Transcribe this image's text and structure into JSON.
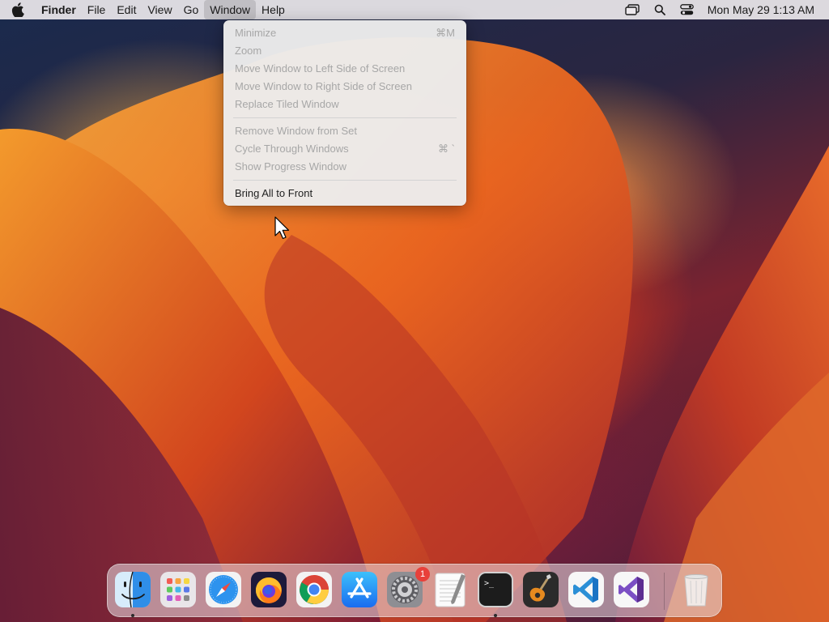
{
  "menubar": {
    "apple_icon": "apple-logo-icon",
    "items": [
      {
        "label": "Finder",
        "bold": true
      },
      {
        "label": "File"
      },
      {
        "label": "Edit"
      },
      {
        "label": "View"
      },
      {
        "label": "Go"
      },
      {
        "label": "Window",
        "active": true
      },
      {
        "label": "Help"
      }
    ],
    "status_icons": [
      "window-switcher-icon",
      "search-icon",
      "control-center-icon"
    ],
    "clock": "Mon May 29  1:13 AM"
  },
  "window_menu": {
    "items": [
      {
        "label": "Minimize",
        "shortcut": "⌘M",
        "enabled": false
      },
      {
        "label": "Zoom",
        "enabled": false
      },
      {
        "label": "Move Window to Left Side of Screen",
        "enabled": false
      },
      {
        "label": "Move Window to Right Side of Screen",
        "enabled": false
      },
      {
        "label": "Replace Tiled Window",
        "enabled": false
      },
      {
        "label": "Remove Window from Set",
        "enabled": false
      },
      {
        "label": "Cycle Through Windows",
        "shortcut": "⌘ `",
        "enabled": false
      },
      {
        "label": "Show Progress Window",
        "enabled": false
      },
      {
        "label": "Bring All to Front",
        "enabled": true
      }
    ]
  },
  "dock": {
    "apps": [
      {
        "name": "Finder",
        "icon": "finder-icon",
        "running": true
      },
      {
        "name": "Launchpad",
        "icon": "launchpad-icon"
      },
      {
        "name": "Safari",
        "icon": "safari-icon"
      },
      {
        "name": "Firefox",
        "icon": "firefox-icon"
      },
      {
        "name": "Google Chrome",
        "icon": "chrome-icon"
      },
      {
        "name": "App Store",
        "icon": "app-store-icon"
      },
      {
        "name": "System Settings",
        "icon": "system-settings-icon",
        "badge": "1"
      },
      {
        "name": "TextEdit",
        "icon": "textedit-icon"
      },
      {
        "name": "Terminal",
        "icon": "terminal-icon",
        "running": true
      },
      {
        "name": "GarageBand",
        "icon": "garageband-icon"
      },
      {
        "name": "Visual Studio Code",
        "icon": "vscode-icon"
      },
      {
        "name": "Visual Studio",
        "icon": "visual-studio-icon"
      },
      {
        "name": "Trash",
        "icon": "trash-icon"
      }
    ],
    "terminal_prompt": ">_"
  },
  "colors": {
    "menu_disabled_text": "#a7a7a7",
    "menu_enabled_text": "#1f1f1f",
    "badge_red": "#e8403a",
    "vscode_blue": "#2b8fd6",
    "visual_studio_purple": "#7b4fc4"
  }
}
